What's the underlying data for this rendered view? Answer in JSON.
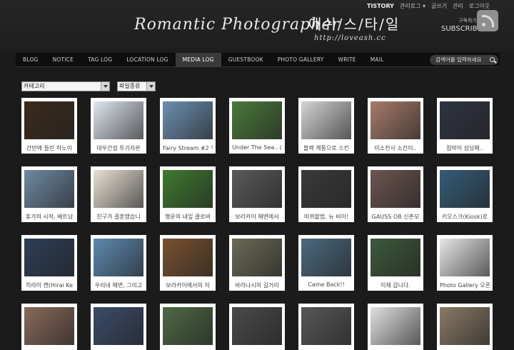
{
  "topbar": {
    "brand": "TISTORY",
    "links": [
      "관리로그 ▾",
      "글쓰기",
      "관리",
      "로그아웃"
    ]
  },
  "header": {
    "title": "Romantic Photographer",
    "korean_name": "애쉬/스/타/일",
    "url": "http://loveash.cc",
    "subscribe_small": "구독하기",
    "subscribe_big": "SUBSCRIBE"
  },
  "nav": {
    "items": [
      "BLOG",
      "NOTICE",
      "TAG LOG",
      "LOCATION LOG",
      "MEDIA LOG",
      "GUESTBOOK",
      "PHOTO GALLERY",
      "WRITE",
      "MAIL"
    ],
    "active": "MEDIA LOG",
    "search_placeholder": "검색어를 입력하세요"
  },
  "filters": {
    "category": "카테고리",
    "filetype": "파일종류"
  },
  "cards": [
    {
      "caption": "간만에 들린 하노이",
      "color": "#3b2a1a"
    },
    {
      "caption": "대우건설 투기자본",
      "color": "#dfe6ef"
    },
    {
      "caption": "Fairy Stream #2 무",
      "color": "#6b8fb0"
    },
    {
      "caption": "Under The Sea.. (",
      "color": "#4a7a3a"
    },
    {
      "caption": "블랙 계통으로 스킨",
      "color": "#d4d4d4"
    },
    {
      "caption": "미소천사 소진이..",
      "color": "#a77b68"
    },
    {
      "caption": "점박이 삼남매..",
      "color": "#2e3340"
    },
    {
      "caption": "휴가의 시작, 베트남",
      "color": "#6f8aa4"
    },
    {
      "caption": "친구가 결혼했습니",
      "color": "#e8e0d4"
    },
    {
      "caption": "행운의 네잎 클로버",
      "color": "#3f7a2e"
    },
    {
      "caption": "보라카이 해변에서",
      "color": "#5a5a5a"
    },
    {
      "caption": "마퀴할멈, 뉴 비이!",
      "color": "#3a3a3a"
    },
    {
      "caption": "GAUSS OB 신촌모",
      "color": "#6b5550"
    },
    {
      "caption": "키오스크(Kiosk)로",
      "color": "#345c78"
    },
    {
      "caption": "히라이 켄(Hirai Ke",
      "color": "#2d3f58"
    },
    {
      "caption": "우리네 해변, 그리고",
      "color": "#5d8ab0"
    },
    {
      "caption": "보라카이에서의 저",
      "color": "#7a5230"
    },
    {
      "caption": "바라나시의 길거리",
      "color": "#6a6a55"
    },
    {
      "caption": "Came Back!!",
      "color": "#4b6a80"
    },
    {
      "caption": "이제 갑니다.",
      "color": "#3c5a3a"
    },
    {
      "caption": "Photo Gallery 오픈",
      "color": "#e6e6e6"
    },
    {
      "caption": "",
      "color": "#8a6a5a"
    },
    {
      "caption": "",
      "color": "#3a4c6a"
    },
    {
      "caption": "",
      "color": "#4e6a44"
    },
    {
      "caption": "",
      "color": "#4a4a4a"
    },
    {
      "caption": "",
      "color": "#575757"
    },
    {
      "caption": "",
      "color": "#e0e0e0"
    },
    {
      "caption": "",
      "color": "#8a7a66"
    }
  ]
}
